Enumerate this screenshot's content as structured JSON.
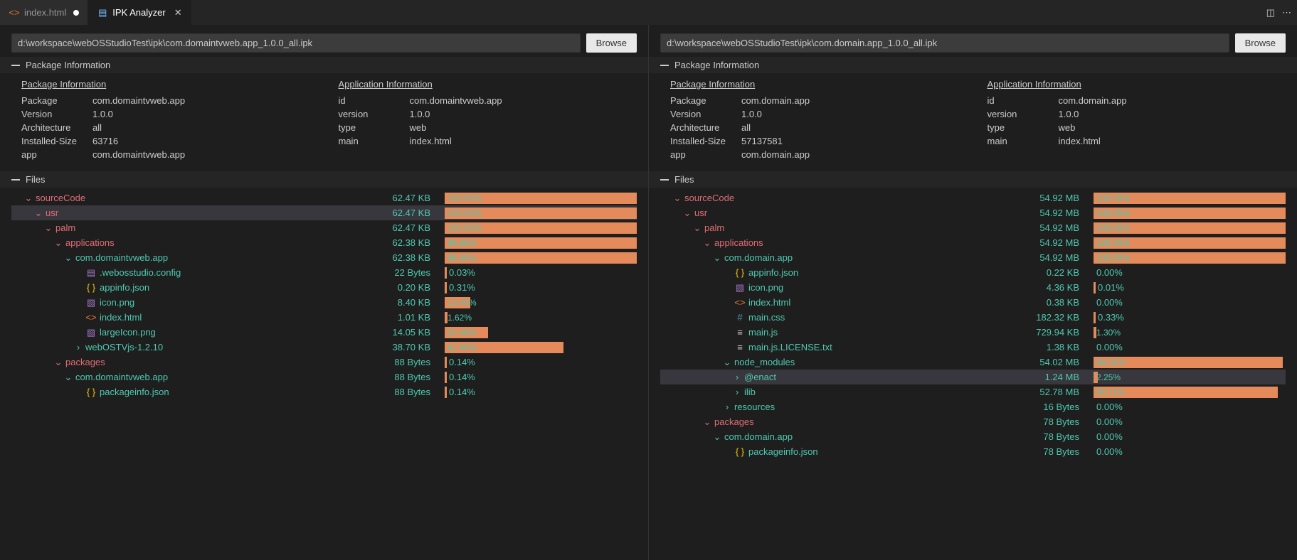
{
  "tabs": [
    {
      "label": "index.html",
      "icon": "html-icon",
      "dirty": true,
      "active": false
    },
    {
      "label": "IPK Analyzer",
      "icon": "preview-icon",
      "dirty": false,
      "active": true
    }
  ],
  "panes": [
    {
      "path": "d:\\workspace\\webOSStudioTest\\ipk\\com.domaintvweb.app_1.0.0_all.ipk",
      "browse": "Browse",
      "section_pkg": "Package Information",
      "section_files": "Files",
      "pkg_head": "Package Information",
      "app_head": "Application Information",
      "pkg": [
        [
          "Package",
          "com.domaintvweb.app"
        ],
        [
          "Version",
          "1.0.0"
        ],
        [
          "Architecture",
          "all"
        ],
        [
          "Installed-Size",
          "63716"
        ],
        [
          "app",
          "com.domaintvweb.app"
        ]
      ],
      "app": [
        [
          "id",
          "com.domaintvweb.app"
        ],
        [
          "version",
          "1.0.0"
        ],
        [
          "type",
          "web"
        ],
        [
          "main",
          "index.html"
        ]
      ],
      "files": [
        {
          "d": 0,
          "t": "dir-open",
          "n": "sourceCode",
          "s": "62.47 KB",
          "p": 100,
          "c": "red",
          "hl": false
        },
        {
          "d": 1,
          "t": "dir-open",
          "n": "usr",
          "s": "62.47 KB",
          "p": 100,
          "c": "red",
          "hl": true
        },
        {
          "d": 2,
          "t": "dir-open",
          "n": "palm",
          "s": "62.47 KB",
          "p": 100,
          "c": "red"
        },
        {
          "d": 3,
          "t": "dir-open",
          "n": "applications",
          "s": "62.38 KB",
          "p": 99.86,
          "c": "red"
        },
        {
          "d": 4,
          "t": "dir-open",
          "n": "com.domaintvweb.app",
          "s": "62.38 KB",
          "p": 99.86,
          "c": "green"
        },
        {
          "d": 5,
          "t": "file",
          "i": "cfg",
          "n": ".webosstudio.config",
          "s": "22 Bytes",
          "p": 0.03,
          "c": "green"
        },
        {
          "d": 5,
          "t": "file",
          "i": "json",
          "n": "appinfo.json",
          "s": "0.20 KB",
          "p": 0.31,
          "c": "green"
        },
        {
          "d": 5,
          "t": "file",
          "i": "img",
          "n": "icon.png",
          "s": "8.40 KB",
          "p": 13.45,
          "c": "green"
        },
        {
          "d": 5,
          "t": "file",
          "i": "html",
          "n": "index.html",
          "s": "1.01 KB",
          "p": 1.62,
          "c": "green"
        },
        {
          "d": 5,
          "t": "file",
          "i": "img",
          "n": "largeIcon.png",
          "s": "14.05 KB",
          "p": 22.48,
          "c": "green"
        },
        {
          "d": 5,
          "t": "dir",
          "n": "webOSTVjs-1.2.10",
          "s": "38.70 KB",
          "p": 61.96,
          "c": "green"
        },
        {
          "d": 3,
          "t": "dir-open",
          "n": "packages",
          "s": "88 Bytes",
          "p": 0.14,
          "c": "red"
        },
        {
          "d": 4,
          "t": "dir-open",
          "n": "com.domaintvweb.app",
          "s": "88 Bytes",
          "p": 0.14,
          "c": "green"
        },
        {
          "d": 5,
          "t": "file",
          "i": "json",
          "n": "packageinfo.json",
          "s": "88 Bytes",
          "p": 0.14,
          "c": "green"
        }
      ]
    },
    {
      "path": "d:\\workspace\\webOSStudioTest\\ipk\\com.domain.app_1.0.0_all.ipk",
      "browse": "Browse",
      "section_pkg": "Package Information",
      "section_files": "Files",
      "pkg_head": "Package Information",
      "app_head": "Application Information",
      "pkg": [
        [
          "Package",
          "com.domain.app"
        ],
        [
          "Version",
          "1.0.0"
        ],
        [
          "Architecture",
          "all"
        ],
        [
          "Installed-Size",
          "57137581"
        ],
        [
          "app",
          "com.domain.app"
        ]
      ],
      "app": [
        [
          "id",
          "com.domain.app"
        ],
        [
          "version",
          "1.0.0"
        ],
        [
          "type",
          "web"
        ],
        [
          "main",
          "index.html"
        ]
      ],
      "files": [
        {
          "d": 0,
          "t": "dir-open",
          "n": "sourceCode",
          "s": "54.92 MB",
          "p": 100,
          "c": "red"
        },
        {
          "d": 1,
          "t": "dir-open",
          "n": "usr",
          "s": "54.92 MB",
          "p": 100,
          "c": "red"
        },
        {
          "d": 2,
          "t": "dir-open",
          "n": "palm",
          "s": "54.92 MB",
          "p": 100,
          "c": "red"
        },
        {
          "d": 3,
          "t": "dir-open",
          "n": "applications",
          "s": "54.92 MB",
          "p": 100,
          "c": "red"
        },
        {
          "d": 4,
          "t": "dir-open",
          "n": "com.domain.app",
          "s": "54.92 MB",
          "p": 100,
          "c": "green"
        },
        {
          "d": 5,
          "t": "file",
          "i": "json",
          "n": "appinfo.json",
          "s": "0.22 KB",
          "p": 0,
          "c": "green"
        },
        {
          "d": 5,
          "t": "file",
          "i": "img",
          "n": "icon.png",
          "s": "4.36 KB",
          "p": 0.01,
          "c": "green"
        },
        {
          "d": 5,
          "t": "file",
          "i": "html",
          "n": "index.html",
          "s": "0.38 KB",
          "p": 0,
          "c": "green"
        },
        {
          "d": 5,
          "t": "file",
          "i": "css",
          "n": "main.css",
          "s": "182.32 KB",
          "p": 0.33,
          "c": "green"
        },
        {
          "d": 5,
          "t": "file",
          "i": "txt",
          "n": "main.js",
          "s": "729.94 KB",
          "p": 1.3,
          "c": "green"
        },
        {
          "d": 5,
          "t": "file",
          "i": "txt",
          "n": "main.js.LICENSE.txt",
          "s": "1.38 KB",
          "p": 0,
          "c": "green"
        },
        {
          "d": 5,
          "t": "dir-open",
          "n": "node_modules",
          "s": "54.02 MB",
          "p": 98.36,
          "c": "green"
        },
        {
          "d": 6,
          "t": "dir",
          "n": "@enact",
          "s": "1.24 MB",
          "p": 2.25,
          "c": "green",
          "hl": true
        },
        {
          "d": 6,
          "t": "dir",
          "n": "ilib",
          "s": "52.78 MB",
          "p": 96.11,
          "c": "green"
        },
        {
          "d": 5,
          "t": "dir",
          "n": "resources",
          "s": "16 Bytes",
          "p": 0,
          "c": "green"
        },
        {
          "d": 3,
          "t": "dir-open",
          "n": "packages",
          "s": "78 Bytes",
          "p": 0,
          "c": "red"
        },
        {
          "d": 4,
          "t": "dir-open",
          "n": "com.domain.app",
          "s": "78 Bytes",
          "p": 0,
          "c": "green"
        },
        {
          "d": 5,
          "t": "file",
          "i": "json",
          "n": "packageinfo.json",
          "s": "78 Bytes",
          "p": 0,
          "c": "green"
        }
      ]
    }
  ]
}
